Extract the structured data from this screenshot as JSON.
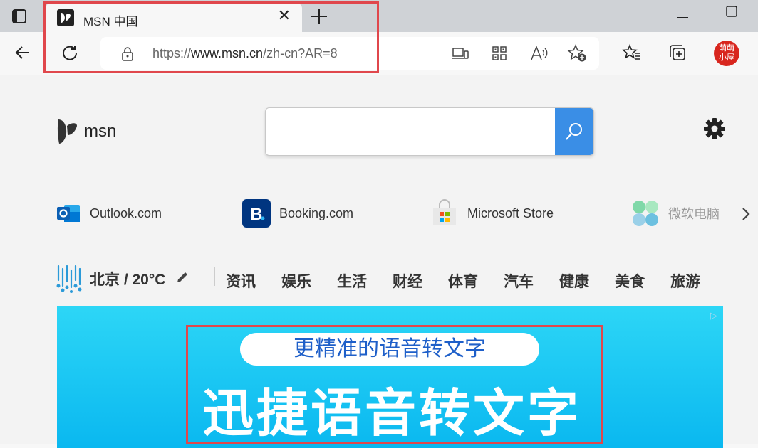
{
  "browser": {
    "tab": {
      "title": "MSN 中国",
      "close_glyph": "✕",
      "icon": "msn-butterfly-icon"
    },
    "new_tab_glyph": "+",
    "address": {
      "prefix": "https://",
      "host": "www.msn.cn",
      "path": "/zh-cn?AR=8"
    },
    "toolbar_icons": [
      "back-arrow-icon",
      "refresh-icon",
      "lock-icon",
      "app-available-icon",
      "qr-code-icon",
      "read-aloud-icon",
      "add-favorite-icon",
      "favorites-icon",
      "collections-icon",
      "profile-avatar"
    ],
    "avatar_text": [
      "萌萌",
      "小屋"
    ]
  },
  "page": {
    "logo_text": "msn",
    "search_placeholder": "",
    "quicklinks": [
      {
        "label": "Outlook.com",
        "icon": "outlook-icon"
      },
      {
        "label": "Booking.com",
        "icon": "booking-icon"
      },
      {
        "label": "Microsoft Store",
        "icon": "store-icon"
      },
      {
        "label": "微软电脑",
        "icon": "microsoft-pc-icon"
      }
    ],
    "weather": {
      "label": "北京 / 20°C",
      "icon": "rain-icon"
    },
    "nav": [
      "资讯",
      "娱乐",
      "生活",
      "财经",
      "体育",
      "汽车",
      "健康",
      "美食",
      "旅游"
    ],
    "ad": {
      "pill_text": "更精准的语音转文字",
      "headline": "迅捷语音转文字",
      "ad_marker": "▷"
    }
  },
  "colors": {
    "accent": "#3a8ee6",
    "highlight": "#e0474c",
    "ad_bg": "#0ab8f0"
  }
}
